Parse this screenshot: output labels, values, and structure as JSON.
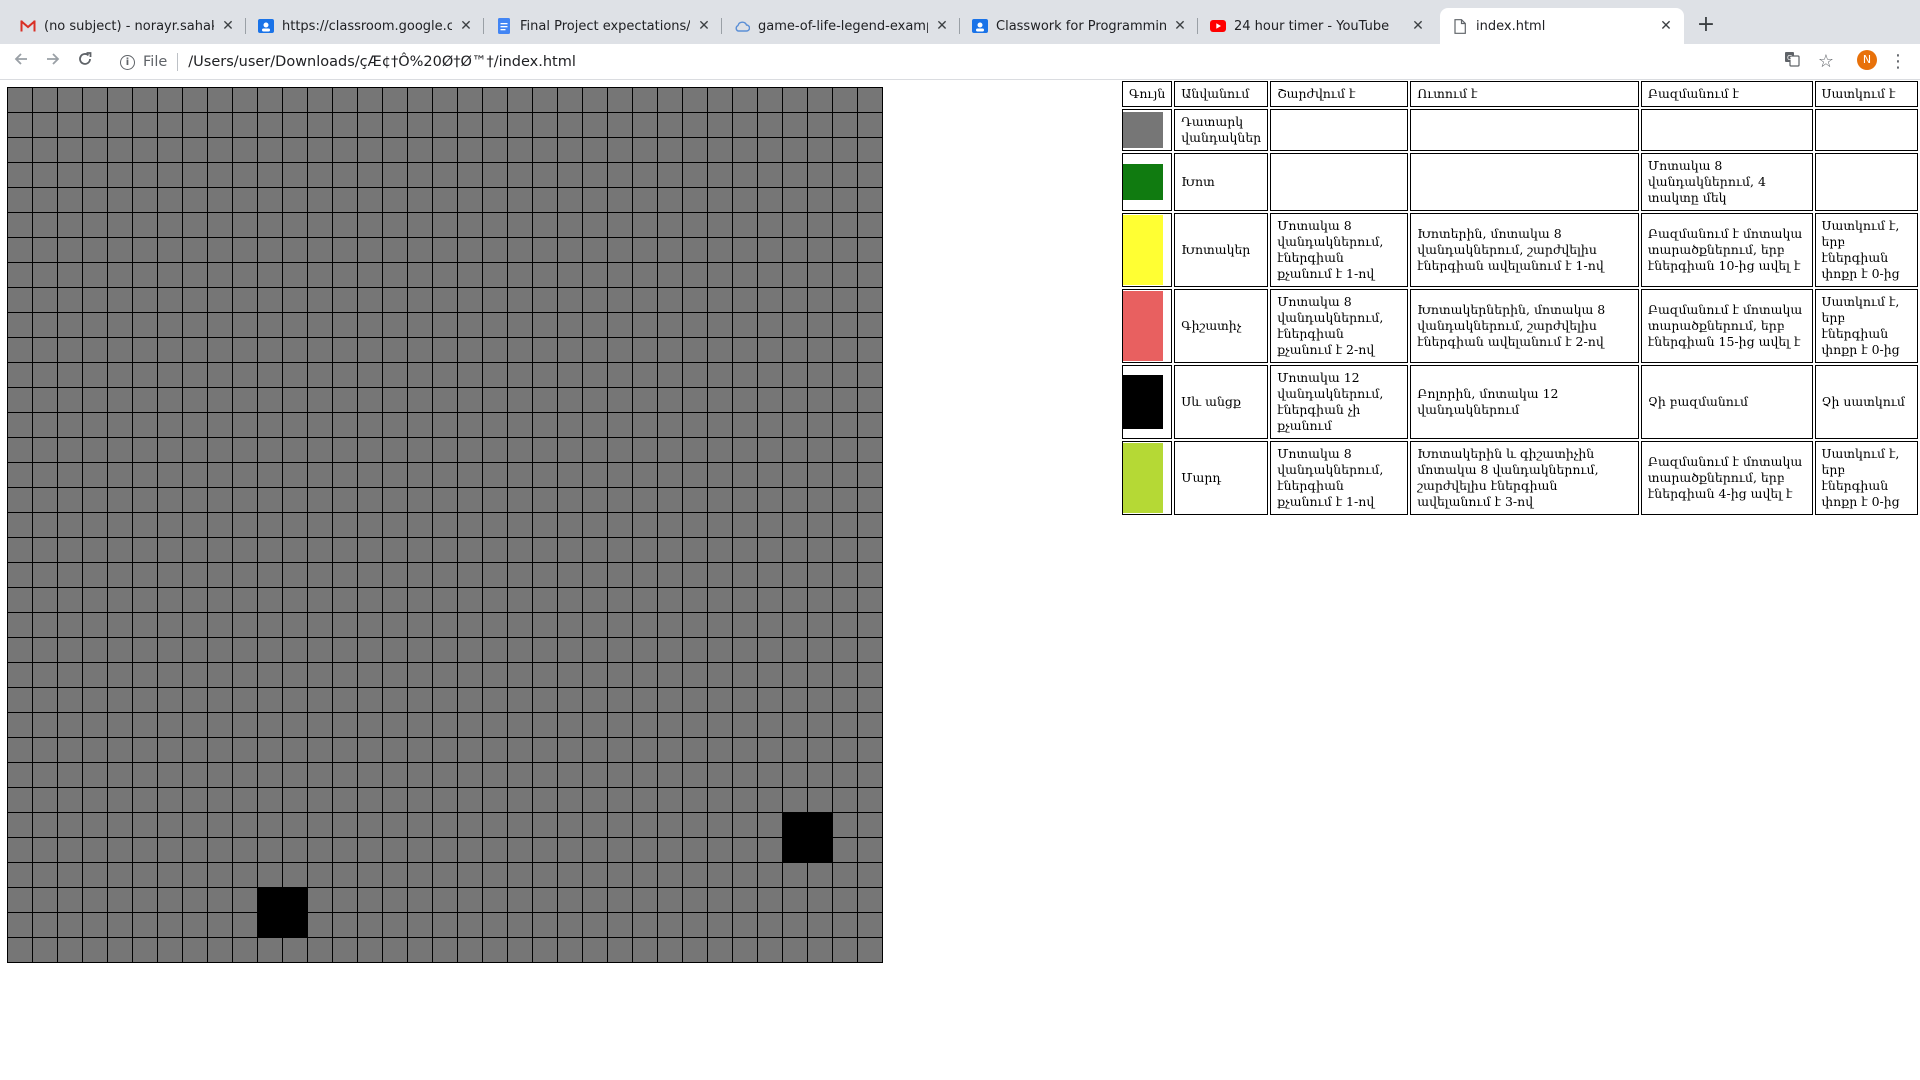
{
  "browser": {
    "tabs": [
      {
        "title": "(no subject) - norayr.sahakyan",
        "icon": "gmail-icon"
      },
      {
        "title": "https://classroom.google.com/",
        "icon": "classroom-icon"
      },
      {
        "title": "Final Project expectations/Աշ",
        "icon": "docs-icon"
      },
      {
        "title": "game-of-life-legend-example",
        "icon": "cloud-icon"
      },
      {
        "title": "Classwork for Programming || A",
        "icon": "classroom-icon"
      },
      {
        "title": "24 hour timer - YouTube",
        "icon": "youtube-icon"
      },
      {
        "title": "index.html",
        "icon": "file-icon"
      }
    ],
    "active_tab_index": 6,
    "new_tab_label": "+",
    "address": {
      "scheme": "File",
      "url": "/Users/user/Downloads/çÆ¢†Ô%20Ø†Ø™†/index.html"
    },
    "profile_initial": "N"
  },
  "grid": {
    "columns": 35,
    "rows": 35,
    "cell_color": "#767676",
    "line_color": "#000000",
    "black_blocks": [
      {
        "col": 31,
        "row": 29
      },
      {
        "col": 10,
        "row": 32
      }
    ]
  },
  "legend": {
    "headers": [
      "Գույն",
      "Անվանում",
      "Շարժվում է",
      "Ուտում է",
      "Բազմանում է",
      "Սատկում է"
    ],
    "rows": [
      {
        "color": "#767676",
        "name": "Դատարկ վանդակներ",
        "moves": "",
        "eats": "",
        "multiplies": "",
        "dies": ""
      },
      {
        "color": "#107b10",
        "name": "Խոտ",
        "moves": "",
        "eats": "",
        "multiplies": "Մոտակա 8 վանդակներում, 4 տակտը մեկ",
        "dies": ""
      },
      {
        "color": "#ffff33",
        "name": "Խոտակեր",
        "moves": "Մոտակա 8 վանդակներում, էներգիան քչանում է 1-ով",
        "eats": "Խոտերին, մոտակա 8 վանդակներում, շարժվելիս էներգիան ավելանում է 1-ով",
        "multiplies": "Բազմանում է մոտակա տարածքներում, երբ էներգիան 10-ից ավել է",
        "dies": "Սատկում է, երբ էներգիան փոքր է 0-ից"
      },
      {
        "color": "#e86060",
        "name": "Գիշատիչ",
        "moves": "Մոտակա 8 վանդակներում, էներգիան քչանում է 2-ով",
        "eats": "Խոտակերներին, մոտակա 8 վանդակներում, շարժվելիս էներգիան ավելանում է 2-ով",
        "multiplies": "Բազմանում է մոտակա տարածքներում, երբ էներգիան 15-ից ավել է",
        "dies": "Սատկում է, երբ էներգիան փոքր է 0-ից"
      },
      {
        "color": "#000000",
        "name": "Սև անցք",
        "moves": "Մոտակա 12 վանդակներում, էներգիան չի քչանում",
        "eats": "Բոլորին, մոտակա 12 վանդակներում",
        "multiplies": "Չի բազմանում",
        "dies": "Չի սատկում"
      },
      {
        "color": "#b5d935",
        "name": "Մարդ",
        "moves": "Մոտակա 8 վանդակներում, էներգիան քչանում է 1-ով",
        "eats": "Խոտակերին և գիշատիչին մոտակա 8 վանդակներում, շարժվելիս էներգիան ավելանում է 3-ով",
        "multiplies": "Բազմանում է մոտակա տարածքներում, երբ էներգիան 4-ից ավել է",
        "dies": "Սատկում է, երբ էներգիան փոքր է 0-ից"
      }
    ]
  }
}
